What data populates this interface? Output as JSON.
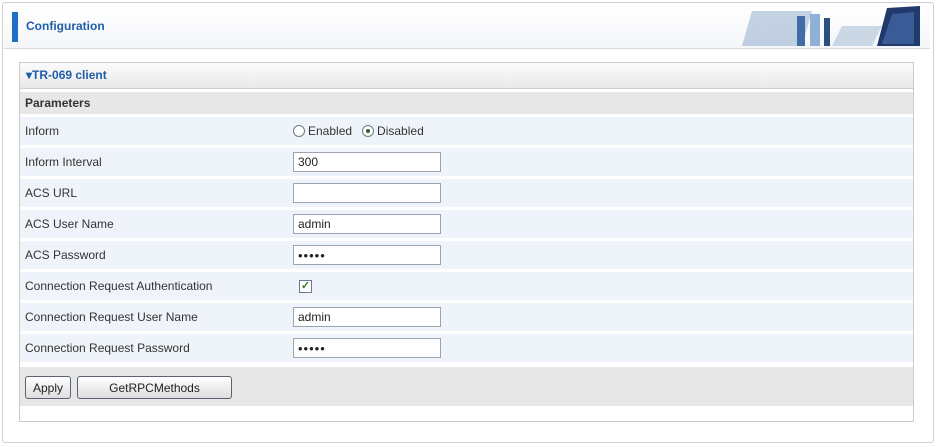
{
  "header": {
    "title": "Configuration"
  },
  "section": {
    "title": "TR-069 client",
    "subtitle": "Parameters"
  },
  "fields": {
    "inform": {
      "label": "Inform",
      "options": [
        "Enabled",
        "Disabled"
      ],
      "selected": "Disabled"
    },
    "inform_interval": {
      "label": "Inform Interval",
      "value": "300"
    },
    "acs_url": {
      "label": "ACS URL",
      "value": ""
    },
    "acs_user": {
      "label": "ACS User Name",
      "value": "admin"
    },
    "acs_password": {
      "label": "ACS Password",
      "value": "•••••"
    },
    "conn_auth": {
      "label": "Connection Request Authentication",
      "checked": true
    },
    "conn_user": {
      "label": "Connection Request User Name",
      "value": "admin"
    },
    "conn_password": {
      "label": "Connection Request Password",
      "value": "•••••"
    }
  },
  "buttons": {
    "apply": "Apply",
    "getrpc": "GetRPCMethods"
  },
  "colors": {
    "accent": "#1f6fc6",
    "row_bg": "#eef4fa",
    "header_bg": "#e7e7e7"
  }
}
